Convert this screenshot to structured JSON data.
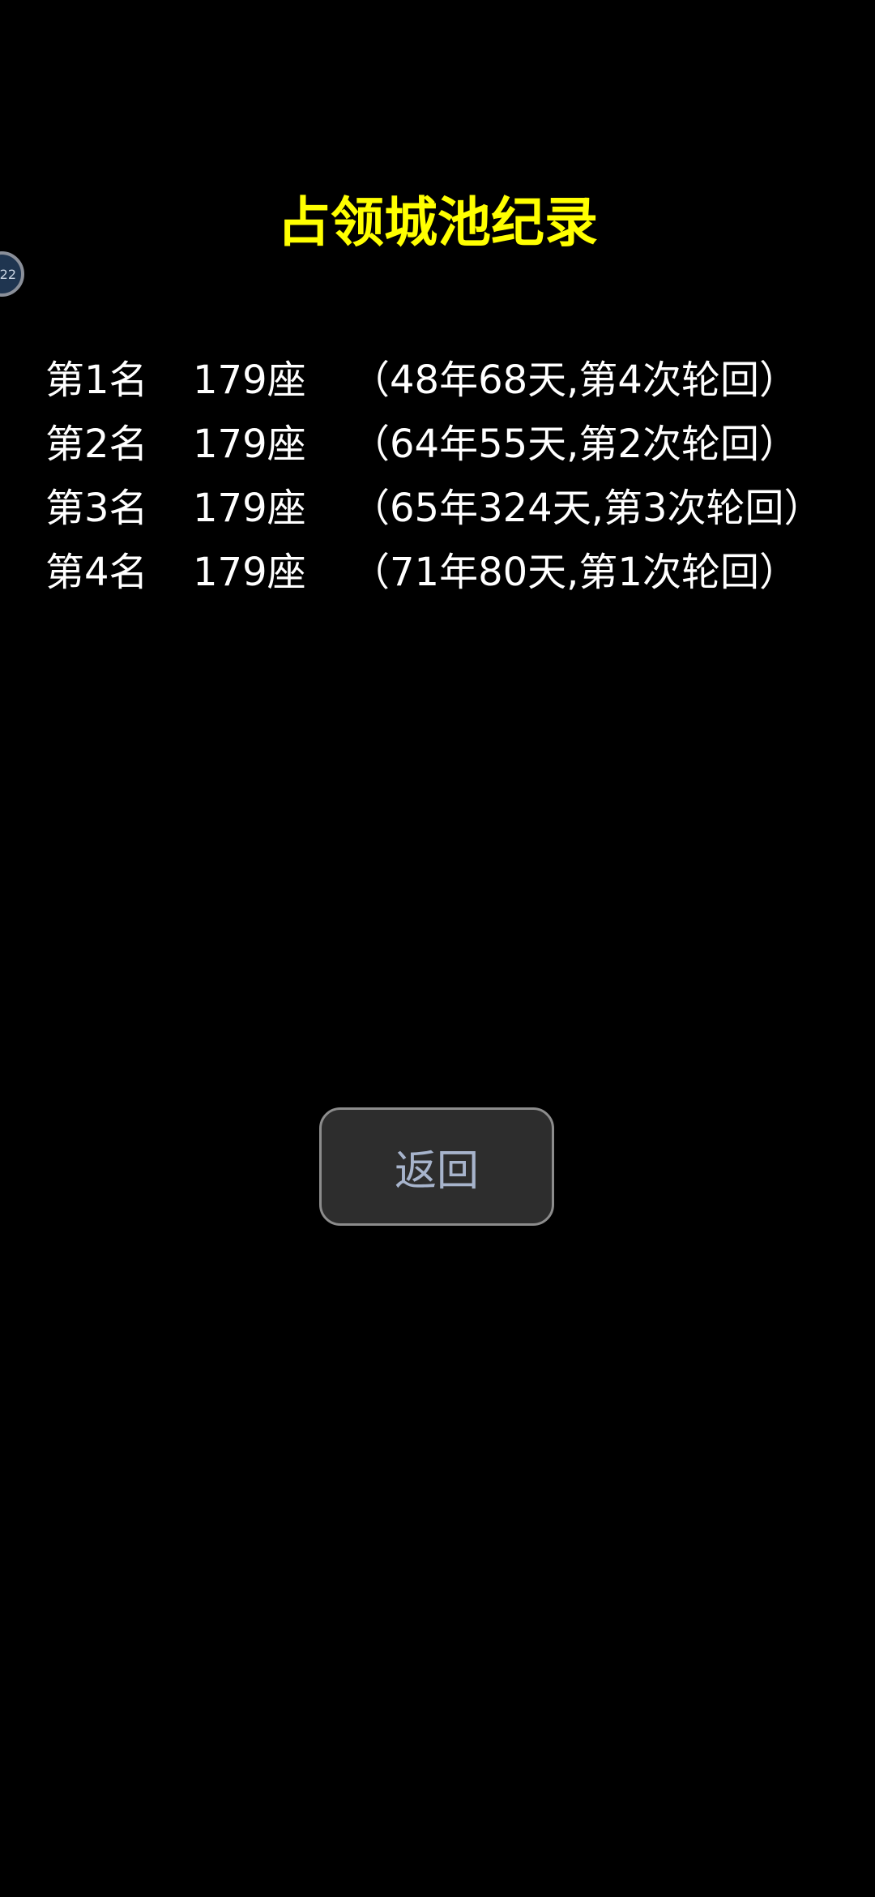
{
  "page": {
    "title": "占领城池纪录",
    "title_color": "#ffff00",
    "background_color": "#000000"
  },
  "floating_bubble": {
    "label": "22"
  },
  "records": [
    {
      "rank": "第1名",
      "count": "179座",
      "detail": "（48年68天,第4次轮回）"
    },
    {
      "rank": "第2名",
      "count": "179座",
      "detail": "（64年55天,第2次轮回）"
    },
    {
      "rank": "第3名",
      "count": "179座",
      "detail": "（65年324天,第3次轮回）"
    },
    {
      "rank": "第4名",
      "count": "179座",
      "detail": "（71年80天,第1次轮回）"
    }
  ],
  "back_button": {
    "label": "返回"
  }
}
